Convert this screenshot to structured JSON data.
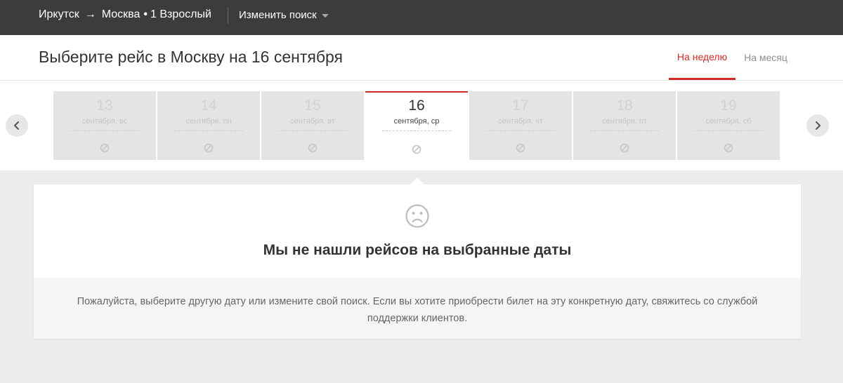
{
  "topbar": {
    "origin": "Иркутск",
    "arrow": "→",
    "destination": "Москва",
    "separator": "•",
    "passengers": "1 Взрослый",
    "change_search_label": "Изменить поиск"
  },
  "header": {
    "title": "Выберите рейс в Москву на 16 сентября",
    "tabs": [
      {
        "label": "На неделю",
        "active": true
      },
      {
        "label": "На месяц",
        "active": false
      }
    ]
  },
  "dates": [
    {
      "day": "13",
      "weekday": "сентября, вс",
      "available": false,
      "active": false
    },
    {
      "day": "14",
      "weekday": "сентября, пн",
      "available": false,
      "active": false
    },
    {
      "day": "15",
      "weekday": "сентября, вт",
      "available": false,
      "active": false
    },
    {
      "day": "16",
      "weekday": "сентября, ср",
      "available": false,
      "active": true
    },
    {
      "day": "17",
      "weekday": "сентября, чт",
      "available": false,
      "active": false
    },
    {
      "day": "18",
      "weekday": "сентября, пт",
      "available": false,
      "active": false
    },
    {
      "day": "19",
      "weekday": "сентября, сб",
      "available": false,
      "active": false
    }
  ],
  "nav": {
    "prev_icon": "chevron-left-icon",
    "next_icon": "chevron-right-icon"
  },
  "empty_state": {
    "icon": "sad-face-icon",
    "title": "Мы не нашли рейсов на выбранные даты",
    "message": "Пожалуйста, выберите другую дату или измените свой поиск. Если вы хотите приобрести билет на эту конкретную дату, свяжитесь со службой поддержки клиентов."
  },
  "colors": {
    "accent": "#d52a27",
    "topbar_bg": "#3c3c3c",
    "page_bg": "#ececec",
    "inactive_day_bg": "#e4e4e4"
  }
}
